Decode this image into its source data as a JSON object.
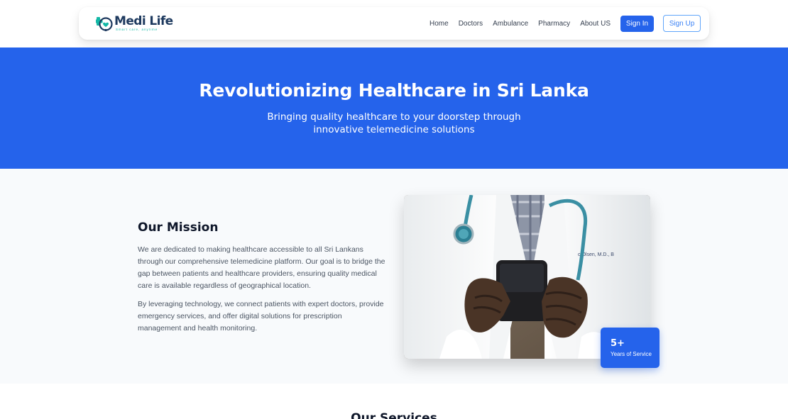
{
  "brand": {
    "name_part1": "Medi",
    "name_part2": "Life",
    "tagline": "Smart care, anytime"
  },
  "nav": {
    "links": [
      "Home",
      "Doctors",
      "Ambulance",
      "Pharmacy",
      "About US"
    ],
    "sign_in": "Sign In",
    "sign_up": "Sign Up"
  },
  "hero": {
    "title": "Revolutionizing Healthcare in Sri Lanka",
    "subtitle": "Bringing quality healthcare to your doorstep through innovative telemedicine solutions"
  },
  "mission": {
    "title": "Our Mission",
    "paragraph1": "We are dedicated to making healthcare accessible to all Sri Lankans through our comprehensive telemedicine platform. Our goal is to bridge the gap between patients and healthcare providers, ensuring quality medical care is available regardless of geographical location.",
    "paragraph2": "By leveraging technology, we connect patients with expert doctors, provide emergency services, and offer digital solutions for prescription management and health monitoring.",
    "image_subject": "doctor-with-smartphone",
    "badge_value": "5+",
    "badge_label": "Years of Service"
  },
  "services": {
    "title": "Our Services"
  },
  "colors": {
    "primary": "#2563eb",
    "hero_bg": "#2563eb",
    "section_bg": "#f8fafc",
    "logo_teal": "#14b8a6",
    "logo_navy": "#1e3a5f"
  }
}
